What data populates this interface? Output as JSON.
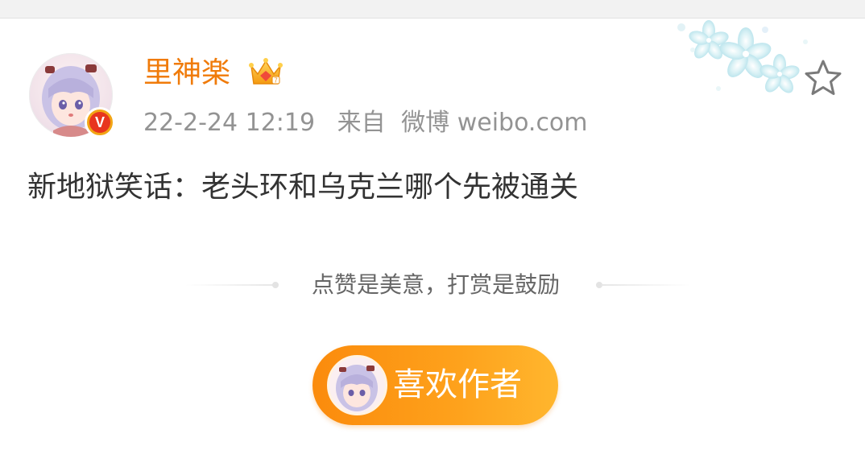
{
  "post": {
    "username": "里神楽",
    "timestamp": "22-2-24 12:19",
    "source_prefix": "来自",
    "source_name": "微博 weibo.com",
    "text": "新地狱笑话：老头环和乌克兰哪个先被通关"
  },
  "badges": {
    "verified_letter": "V",
    "crown_icon": "crown-icon",
    "verified_icon": "verified-v-icon"
  },
  "reward": {
    "slogan": "点赞是美意，打赏是鼓励",
    "button_label": "喜欢作者"
  },
  "colors": {
    "username": "#f07b0a",
    "button_start": "#fb8b0c",
    "button_end": "#ffb62e",
    "meta": "#939393",
    "body_text": "#333333"
  }
}
